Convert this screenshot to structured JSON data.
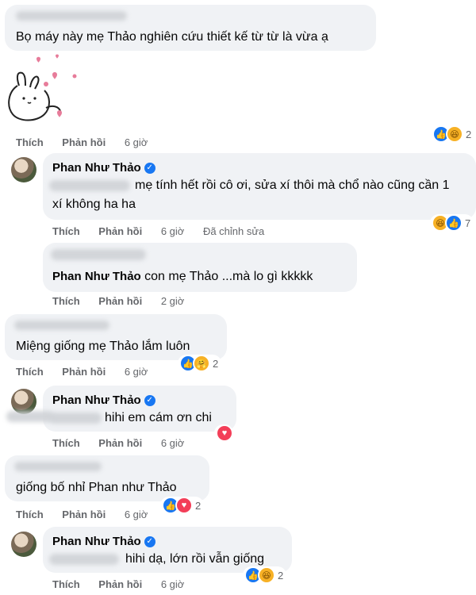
{
  "comments": [
    {
      "text": "Bọ máy này mẹ Thảo nghiên cứu thiết kế từ từ là vừa ạ",
      "actions": [
        "Thích",
        "Phản hồi"
      ],
      "time": "6 giờ",
      "reaction_count": "2",
      "reactions": [
        "like-icon",
        "haha-icon"
      ]
    },
    {
      "author": "Phan Như Thảo",
      "text_line1": "mẹ tính hết rồi cô ơi, sửa xí thôi mà chổ nào cũng cần 1",
      "text_line2": "xí không ha ha",
      "actions": [
        "Thích",
        "Phản hồi"
      ],
      "time": "6 giờ",
      "edited": "Đã chỉnh sửa",
      "reaction_count": "7",
      "reactions": [
        "haha-icon",
        "like-icon"
      ]
    },
    {
      "mention": "Phan Như Thảo",
      "text": "con mẹ Thảo ...mà lo gì kkkkk",
      "actions": [
        "Thích",
        "Phản hồi"
      ],
      "time": "2 giờ"
    },
    {
      "text": "Miệng giống mẹ Thảo lắm luôn",
      "actions": [
        "Thích",
        "Phản hồi"
      ],
      "time": "6 giờ",
      "reaction_count": "2",
      "reactions": [
        "like-icon",
        "care-icon"
      ]
    },
    {
      "author": "Phan Như Thảo",
      "text": "hihi em cám ơn chi",
      "actions": [
        "Thích",
        "Phản hồi"
      ],
      "time": "6 giờ",
      "reactions": [
        "love-icon"
      ]
    },
    {
      "text": "giống bố nhỉ Phan như Thảo",
      "actions": [
        "Thích",
        "Phản hồi"
      ],
      "time": "6 giờ",
      "reaction_count": "2",
      "reactions": [
        "like-icon",
        "love-icon"
      ]
    },
    {
      "author": "Phan Như Thảo",
      "text": "hihi dạ, lớn rồi vẫn giống",
      "actions": [
        "Thích",
        "Phản hồi"
      ],
      "time": "6 giờ",
      "reaction_count": "2",
      "reactions": [
        "like-icon",
        "haha-icon"
      ]
    }
  ],
  "colors": {
    "bubble": "#f0f2f5",
    "meta": "#65676b",
    "like": "#1877f2",
    "love": "#f33e58",
    "haha": "#f7b125"
  }
}
